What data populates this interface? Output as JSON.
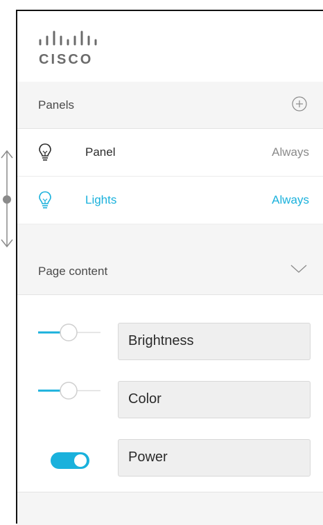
{
  "brand": {
    "logo_text": "CISCO",
    "logo_icon": "cisco-bars-logo"
  },
  "panels_section": {
    "title": "Panels",
    "add_icon": "plus-circle-icon",
    "items": [
      {
        "icon": "lightbulb-icon",
        "name": "Panel",
        "when": "Always",
        "active": false
      },
      {
        "icon": "lightbulb-icon",
        "name": "Lights",
        "when": "Always",
        "active": true
      }
    ]
  },
  "page_content_section": {
    "title": "Page content",
    "toggle_icon": "chevron-down-icon",
    "controls": [
      {
        "type": "slider",
        "label": "Brightness",
        "value": 0.45
      },
      {
        "type": "slider",
        "label": "Color",
        "value": 0.45
      },
      {
        "type": "toggle",
        "label": "Power",
        "on": true
      }
    ]
  },
  "colors": {
    "accent": "#1ab1dc",
    "section_bg": "#f5f5f5",
    "field_bg": "#efefef"
  }
}
